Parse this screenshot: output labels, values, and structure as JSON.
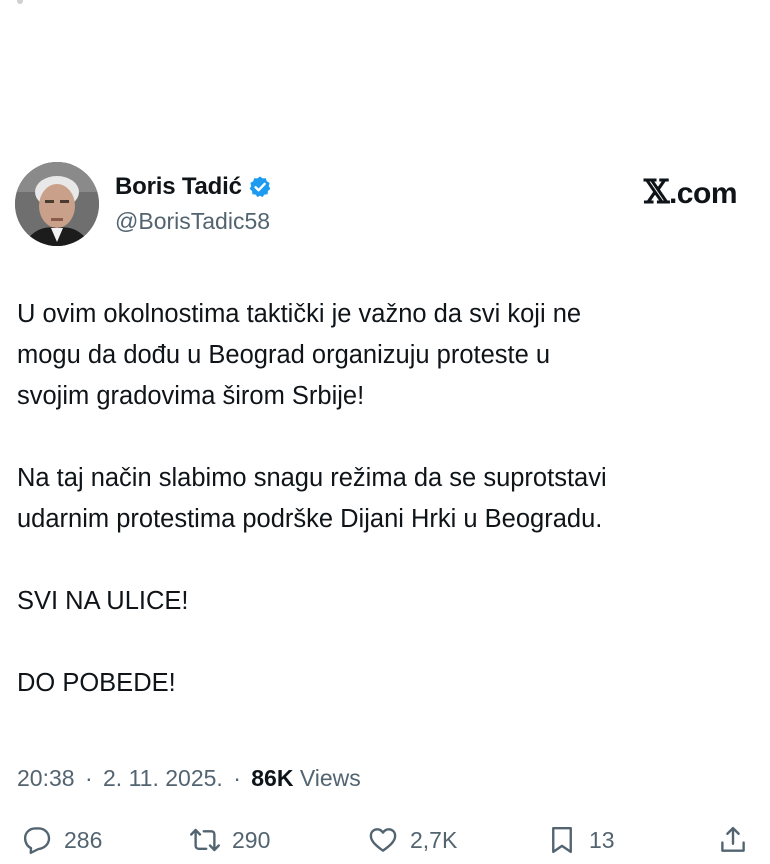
{
  "post": {
    "author": {
      "display_name": "Boris Tadić",
      "handle": "@BorisTadic58",
      "verified": true
    },
    "site_label": "X.com",
    "paragraphs": [
      "U ovim okolnostima taktički je važno da svi koji ne\nmogu da dođu u Beograd organizuju proteste u\nsvojim gradovima širom Srbije!",
      "Na taj način slabimo snagu režima da se suprotstavi\nudarnim protestima podrške Dijani Hrki u Beogradu.",
      "SVI NA ULICE!",
      "DO POBEDE!"
    ],
    "meta": {
      "time": "20:38",
      "separator": "·",
      "date": "2. 11. 2025.",
      "views_count": "86K",
      "views_label": "Views"
    },
    "actions": {
      "replies": "286",
      "reposts": "290",
      "likes": "2,7K",
      "bookmarks": "13"
    }
  },
  "colors": {
    "text": "#0f1419",
    "secondary": "#536471",
    "verified": "#1d9bf0"
  },
  "icons": [
    "verified-badge-icon",
    "reply-icon",
    "repost-icon",
    "like-icon",
    "bookmark-icon",
    "share-icon"
  ]
}
